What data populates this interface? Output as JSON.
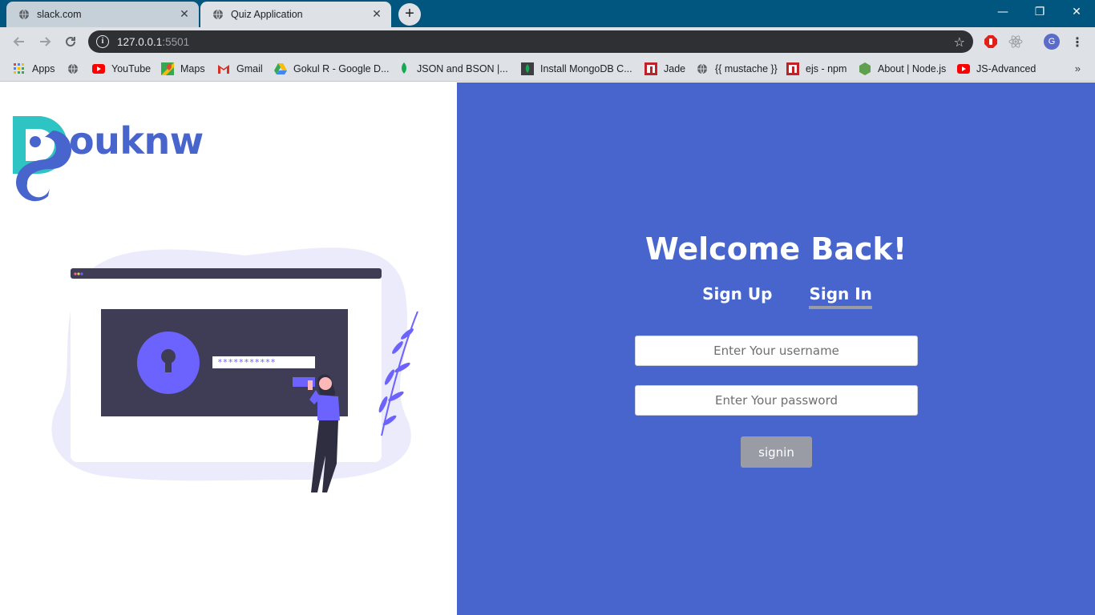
{
  "browser": {
    "tabs": [
      {
        "title": "slack.com",
        "icon": "globe-icon",
        "active": false
      },
      {
        "title": "Quiz Application",
        "icon": "globe-icon",
        "active": true
      }
    ],
    "new_tab_symbol": "+",
    "window_controls": {
      "minimize": "—",
      "restore": "❐",
      "close": "✕"
    },
    "address": {
      "host": "127.0.0.1",
      "port": ":5501"
    },
    "profile_initial": "G",
    "bookmarks": [
      {
        "label": "Apps",
        "icon": "apps-grid-icon"
      },
      {
        "label": "",
        "icon": "globe-icon"
      },
      {
        "label": "YouTube",
        "icon": "youtube-icon"
      },
      {
        "label": "Maps",
        "icon": "maps-icon"
      },
      {
        "label": "Gmail",
        "icon": "gmail-icon"
      },
      {
        "label": "Gokul R - Google D...",
        "icon": "google-drive-icon"
      },
      {
        "label": "JSON and BSON |...",
        "icon": "mongodb-leaf-icon"
      },
      {
        "label": "Install MongoDB C...",
        "icon": "mongodb-icon"
      },
      {
        "label": "Jade",
        "icon": "npm-icon"
      },
      {
        "label": "{{ mustache }}",
        "icon": "globe-icon"
      },
      {
        "label": "ejs - npm",
        "icon": "npm-icon"
      },
      {
        "label": "About | Node.js",
        "icon": "nodejs-icon"
      },
      {
        "label": "JS-Advanced",
        "icon": "youtube-icon"
      }
    ],
    "bookmarks_more": "»"
  },
  "brand": {
    "name": "ouknw",
    "accent": "#4865cd",
    "teal": "#2ec4c4"
  },
  "auth": {
    "heading": "Welcome Back!",
    "tabs": [
      {
        "label": "Sign Up",
        "selected": false
      },
      {
        "label": "Sign In",
        "selected": true
      }
    ],
    "username_placeholder": "Enter Your username",
    "password_placeholder": "Enter Your password",
    "submit_label": "signin"
  },
  "illustration": {
    "password_mask": "***********"
  },
  "colors": {
    "panel": "#4865cd",
    "button": "#9a9ca5",
    "titlebar": "#00567f"
  }
}
